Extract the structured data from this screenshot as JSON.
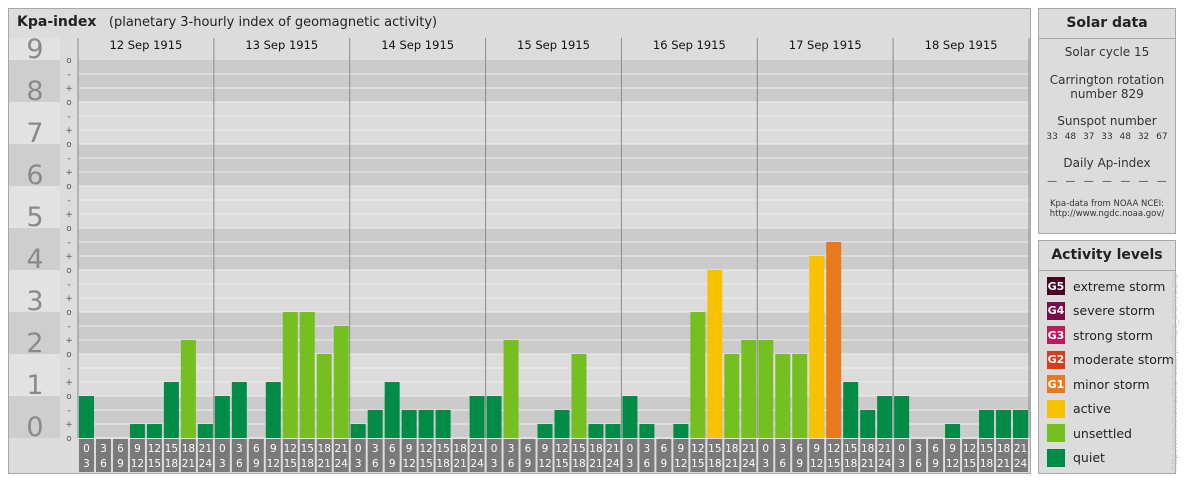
{
  "header": {
    "title": "Kpa-index",
    "subtitle": "(planetary 3-hourly index of geomagnetic activity)"
  },
  "chart_data": {
    "type": "bar",
    "title": "Kpa-index",
    "subtitle": "(planetary 3-hourly index of geomagnetic activity)",
    "ylim": [
      0,
      9
    ],
    "y_ticks": [
      "0",
      "1",
      "2",
      "3",
      "4",
      "5",
      "6",
      "7",
      "8",
      "9"
    ],
    "minor_marks": [
      "-",
      "o",
      "+"
    ],
    "days": [
      "12 Sep 1915",
      "13 Sep 1915",
      "14 Sep 1915",
      "15 Sep 1915",
      "16 Sep 1915",
      "17 Sep 1915",
      "18 Sep 1915"
    ],
    "interval_starts": [
      "0",
      "3",
      "6",
      "9",
      "12",
      "15",
      "18",
      "21"
    ],
    "interval_ends": [
      "3",
      "6",
      "9",
      "12",
      "15",
      "18",
      "21",
      "24"
    ],
    "values": [
      [
        1.0,
        0.0,
        0.0,
        0.333,
        0.333,
        1.333,
        2.333,
        0.333
      ],
      [
        1.0,
        1.333,
        0.0,
        1.333,
        3.0,
        3.0,
        2.0,
        2.667
      ],
      [
        0.333,
        0.667,
        1.333,
        0.667,
        0.667,
        0.667,
        0.0,
        1.0
      ],
      [
        1.0,
        2.333,
        0.0,
        0.333,
        0.667,
        2.0,
        0.333,
        0.333
      ],
      [
        1.0,
        0.333,
        0.0,
        0.333,
        3.0,
        4.0,
        2.0,
        2.333
      ],
      [
        2.333,
        2.0,
        2.0,
        4.333,
        4.667,
        1.333,
        0.667,
        1.0
      ],
      [
        1.0,
        0.0,
        0.0,
        0.333,
        0.0,
        0.667,
        0.667,
        0.667
      ]
    ],
    "colors": {
      "quiet": "#008c47",
      "unsettled": "#76bf20",
      "active": "#f7c300",
      "minor_storm": "#e8791d",
      "moderate_storm": "#da3a1d",
      "strong_storm": "#c01a5c",
      "severe_storm": "#7a0b4b",
      "extreme_storm": "#4a0020"
    },
    "grid": true
  },
  "solar": {
    "title": "Solar data",
    "cycle": "Solar cycle 15",
    "carrington_line1": "Carrington rotation",
    "carrington_line2": "number 829",
    "sunspot_title": "Sunspot number",
    "sunspots": [
      "33",
      "48",
      "37",
      "33",
      "48",
      "32",
      "67"
    ],
    "ap_title": "Daily Ap-index",
    "ap_values": [
      "—",
      "—",
      "—",
      "—",
      "—",
      "—",
      "—"
    ],
    "source_line1": "Kpa-data from NOAA NCEI:",
    "source_line2": "http://www.ngdc.noaa.gov/"
  },
  "levels": {
    "title": "Activity levels",
    "items": [
      {
        "badge": "G5",
        "label": "extreme storm",
        "color": "#4a0020"
      },
      {
        "badge": "G4",
        "label": "severe storm",
        "color": "#7a0b4b"
      },
      {
        "badge": "G3",
        "label": "strong storm",
        "color": "#c01a5c"
      },
      {
        "badge": "G2",
        "label": "moderate storm",
        "color": "#da3a1d"
      },
      {
        "badge": "G1",
        "label": "minor storm",
        "color": "#e8791d"
      },
      {
        "badge": "",
        "label": "active",
        "color": "#f7c300"
      },
      {
        "badge": "",
        "label": "unsettled",
        "color": "#76bf20"
      },
      {
        "badge": "",
        "label": "quiet",
        "color": "#008c47"
      }
    ]
  },
  "watermark": "http://www.theweatherfactory.nl/kpa_archive.php"
}
